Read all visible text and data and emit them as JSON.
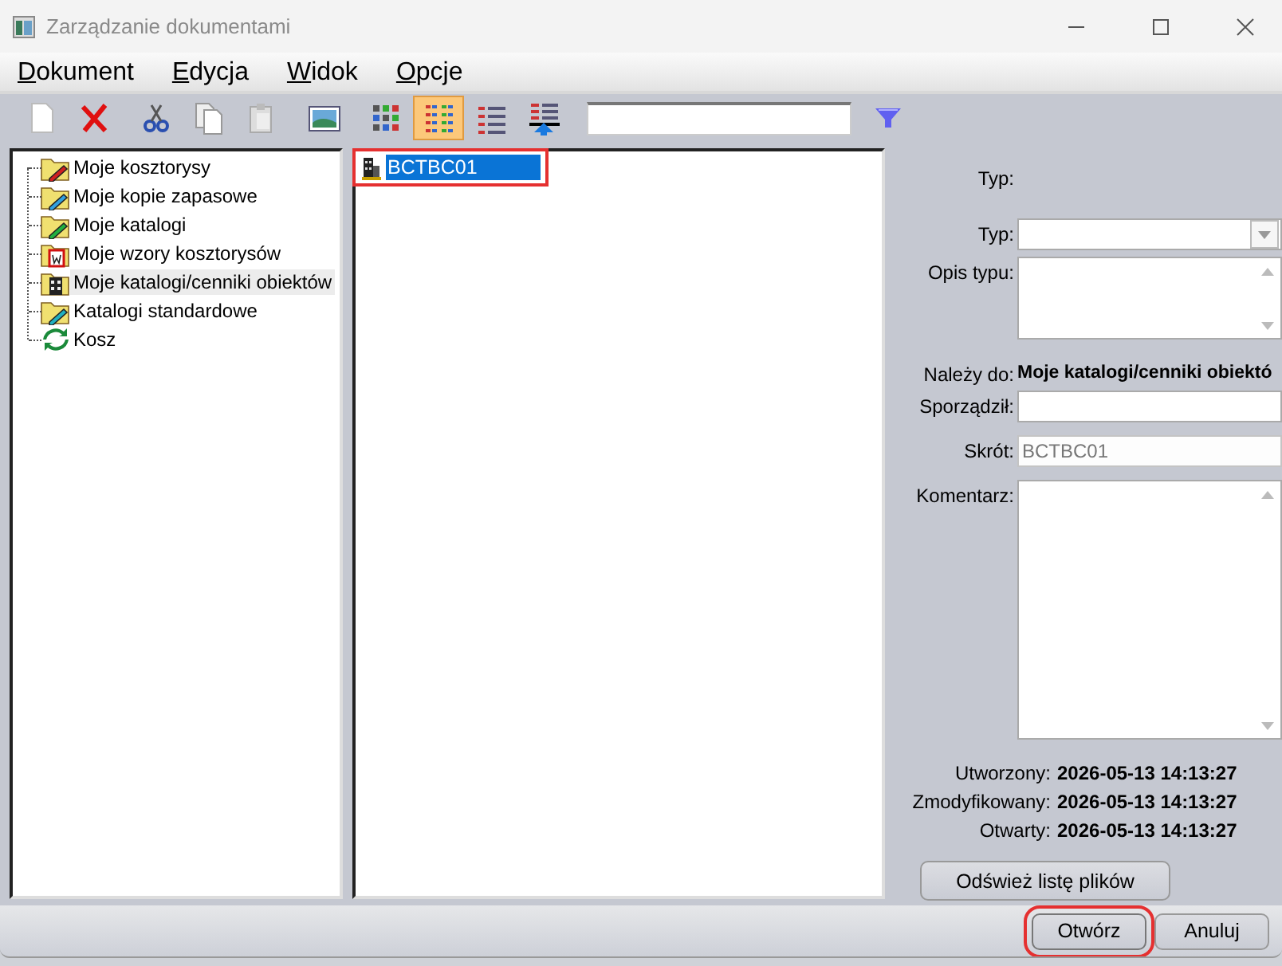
{
  "window": {
    "title": "Zarządzanie dokumentami"
  },
  "menu": [
    {
      "label": "Dokument"
    },
    {
      "label": "Edycja"
    },
    {
      "label": "Widok"
    },
    {
      "label": "Opcje"
    }
  ],
  "toolbar": {
    "buttons": [
      {
        "kind": "new",
        "selected": false
      },
      {
        "kind": "delete",
        "selected": false
      },
      {
        "kind": "cut",
        "selected": false
      },
      {
        "kind": "copy",
        "selected": false
      },
      {
        "kind": "paste",
        "selected": false
      },
      {
        "kind": "image",
        "selected": false
      },
      {
        "kind": "view-icons",
        "selected": false
      },
      {
        "kind": "view-list",
        "selected": true
      },
      {
        "kind": "view-details",
        "selected": false
      },
      {
        "kind": "view-up",
        "selected": false
      }
    ]
  },
  "tree": {
    "items": [
      {
        "label": "Moje kosztorysy",
        "kind": "folder-red",
        "selected": false
      },
      {
        "label": "Moje kopie zapasowe",
        "kind": "folder-blue",
        "selected": false
      },
      {
        "label": "Moje katalogi",
        "kind": "folder-green",
        "selected": false
      },
      {
        "label": "Moje wzory kosztorysów",
        "kind": "folder-template",
        "selected": false
      },
      {
        "label": "Moje katalogi/cenniki obiektów",
        "kind": "folder-building",
        "selected": true
      },
      {
        "label": "Katalogi standardowe",
        "kind": "folder-cyan",
        "selected": false
      },
      {
        "label": "Kosz",
        "kind": "recycle",
        "selected": false
      }
    ]
  },
  "files": [
    {
      "name": "BCTBC01",
      "selected": true,
      "annotated": true
    }
  ],
  "properties": {
    "heading": "Typ:",
    "fields": [
      {
        "kind": "combo",
        "label": "Typ:"
      },
      {
        "kind": "textarea",
        "label": "Opis typu:"
      },
      {
        "kind": "text",
        "label": "Należy do:",
        "value": "Moje katalogi/cenniki obiektó"
      },
      {
        "kind": "input",
        "label": "Sporządził:",
        "disabled": false
      },
      {
        "kind": "input",
        "label": "Skrót:",
        "value": "BCTBC01",
        "disabled": true
      },
      {
        "kind": "textarea-large",
        "label": "Komentarz:"
      }
    ],
    "dates": [
      {
        "label": "Utworzony:",
        "value": "2026-05-13 14:13:27"
      },
      {
        "label": "Zmodyfikowany:",
        "value": "2026-05-13 14:13:27"
      },
      {
        "label": "Otwarty:",
        "value": "2026-05-13 14:13:27"
      }
    ],
    "refresh_button": "Odśwież listę plików"
  },
  "buttons": [
    {
      "label": "Otwórz",
      "default": true,
      "annotated": true
    },
    {
      "label": "Anuluj",
      "default": false,
      "annotated": false
    }
  ]
}
